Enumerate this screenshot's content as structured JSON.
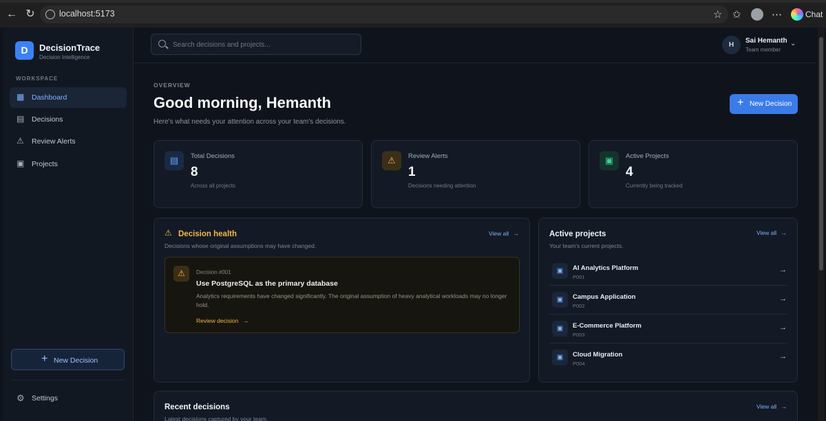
{
  "browser": {
    "url": "localhost:5173",
    "chat_label": "Chat"
  },
  "sidebar": {
    "brand_initial": "D",
    "brand_name": "DecisionTrace",
    "brand_tagline": "Decision Intelligence",
    "section_label": "WORKSPACE",
    "items": [
      {
        "label": "Dashboard",
        "icon": "grid-icon",
        "active": true
      },
      {
        "label": "Decisions",
        "icon": "document-icon"
      },
      {
        "label": "Review Alerts",
        "icon": "warning-icon"
      },
      {
        "label": "Projects",
        "icon": "folder-icon"
      }
    ],
    "new_decision_label": "New Decision",
    "settings_label": "Settings"
  },
  "topbar": {
    "search_placeholder": "Search decisions and projects...",
    "user_initial": "H",
    "user_name": "Sai Hemanth",
    "user_role": "Team member"
  },
  "main": {
    "overline": "OVERVIEW",
    "greeting": "Good morning, Hemanth",
    "subtitle": "Here's what needs your attention across your team's decisions.",
    "new_decision_label": "New Decision",
    "stats": [
      {
        "label": "Total Decisions",
        "value": "8",
        "note": "Across all projects",
        "icon": "document-icon",
        "color": "#60a5fa"
      },
      {
        "label": "Review Alerts",
        "value": "1",
        "note": "Decisions needing attention",
        "icon": "warning-icon",
        "color": "#f3b64a"
      },
      {
        "label": "Active Projects",
        "value": "4",
        "note": "Currently being tracked",
        "icon": "folder-icon",
        "color": "#34d399"
      }
    ],
    "health": {
      "title": "Decision health",
      "subtitle": "Decisions whose original assumptions may have changed.",
      "view_all": "View all",
      "alert": {
        "number": "Decision #001",
        "title": "Use PostgreSQL as the primary database",
        "description": "Analytics requirements have changed significantly. The original assumption of heavy analytical workloads may no longer hold.",
        "link": "Review decision"
      }
    },
    "projects": {
      "title": "Active projects",
      "subtitle": "Your team's current projects.",
      "view_all": "View all",
      "items": [
        {
          "name": "AI Analytics Platform",
          "code": "P001"
        },
        {
          "name": "Campus Application",
          "code": "P002"
        },
        {
          "name": "E-Commerce Platform",
          "code": "P003"
        },
        {
          "name": "Cloud Migration",
          "code": "P004"
        }
      ]
    },
    "recent": {
      "title": "Recent decisions",
      "subtitle": "Latest decisions captured by your team.",
      "view_all": "View all"
    }
  }
}
